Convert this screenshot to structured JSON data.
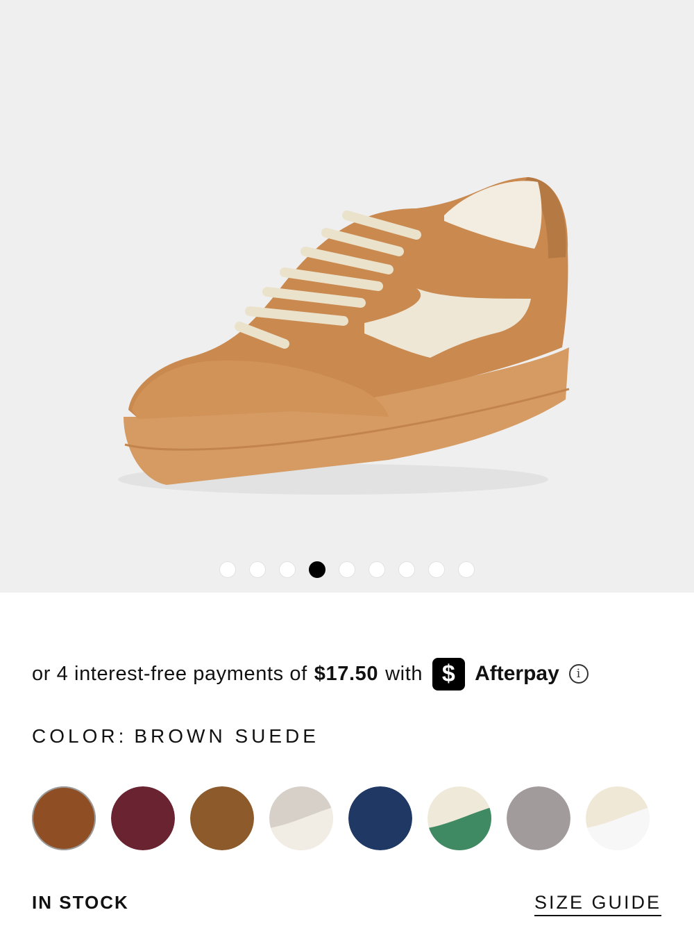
{
  "gallery": {
    "image_alt": "Brown suede sneaker with cream leather stripe and gum sole",
    "dot_count": 9,
    "active_index": 3
  },
  "afterpay": {
    "prefix": "or 4 interest-free payments of",
    "amount": "$17.50",
    "with": "with",
    "logo_glyph": "$",
    "brand": "Afterpay",
    "info_glyph": "i"
  },
  "color": {
    "label": "COLOR:",
    "value": "BROWN SUEDE"
  },
  "swatches": [
    {
      "name": "brown-suede",
      "primary": "#8f4e23",
      "secondary": "#8f4e23",
      "selected": true
    },
    {
      "name": "burgundy-suede",
      "primary": "#6a2330",
      "secondary": "#6a2330",
      "selected": false
    },
    {
      "name": "tan-suede",
      "primary": "#8c5a2b",
      "secondary": "#8c5a2b",
      "selected": false
    },
    {
      "name": "light-grey-suede",
      "primary": "#d6d0c8",
      "secondary": "#f1ede4",
      "selected": false
    },
    {
      "name": "navy-suede",
      "primary": "#1f3864",
      "secondary": "#1f3864",
      "selected": false
    },
    {
      "name": "cream-green",
      "primary": "#efe9d9",
      "secondary": "#3f8a63",
      "selected": false
    },
    {
      "name": "grey-suede",
      "primary": "#a19c9b",
      "secondary": "#a19c9b",
      "selected": false
    },
    {
      "name": "cream-white",
      "primary": "#efe8d6",
      "secondary": "#f7f7f7",
      "selected": false
    }
  ],
  "stock": {
    "label": "IN STOCK"
  },
  "size_guide": {
    "label": "SIZE GUIDE"
  }
}
